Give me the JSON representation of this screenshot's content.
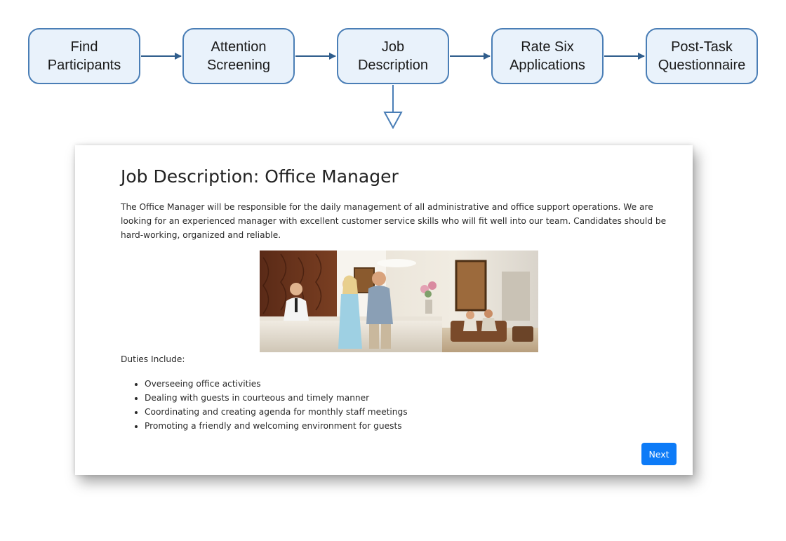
{
  "flow": {
    "steps": [
      {
        "label": "Find\nParticipants"
      },
      {
        "label": "Attention\nScreening"
      },
      {
        "label": "Job\nDescription"
      },
      {
        "label": "Rate Six\nApplications"
      },
      {
        "label": "Post-Task\nQuestionnaire"
      }
    ],
    "colors": {
      "border": "#4a7eb6",
      "fill": "#e9f2fb",
      "arrow": "#2f5d8c"
    }
  },
  "page": {
    "title": "Job Description: Office Manager",
    "description": "The Office Manager will be responsible for the daily management of all administrative and office support operations. We are looking for an experienced manager with excellent customer service skills who will fit well into our team. Candidates should be hard-working, organized and reliable.",
    "duties_label": "Duties Include:",
    "duties": [
      "Overseeing office activities",
      "Dealing with guests in courteous and timely manner",
      "Coordinating and creating agenda for monthly staff meetings",
      "Promoting a friendly and welcoming environment for guests"
    ],
    "next_label": "Next",
    "accent": "#0d7bf7"
  }
}
